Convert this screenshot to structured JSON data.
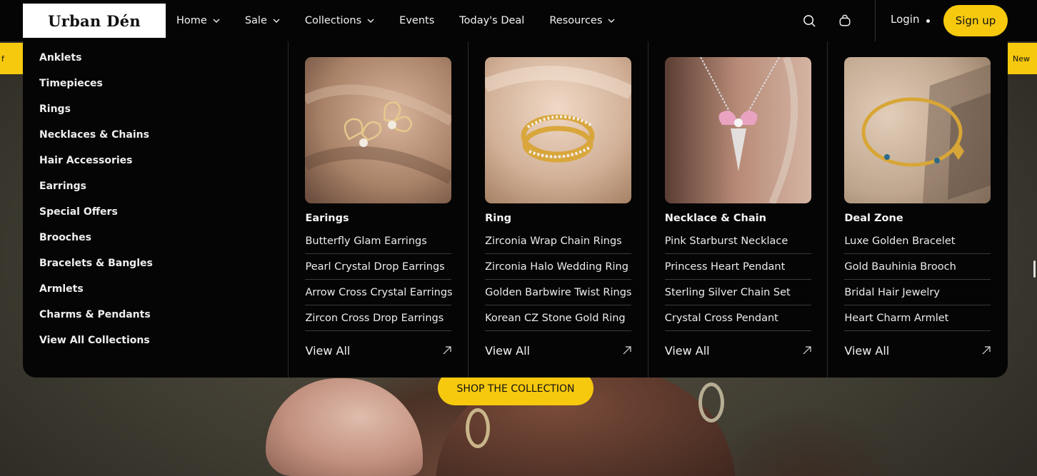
{
  "brand": {
    "logo_text": "Urban Dén"
  },
  "nav": {
    "items": [
      {
        "label": "Home",
        "dropdown": true
      },
      {
        "label": "Sale",
        "dropdown": true
      },
      {
        "label": "Collections",
        "dropdown": true
      },
      {
        "label": "Events",
        "dropdown": false
      },
      {
        "label": "Today's Deal",
        "dropdown": false
      },
      {
        "label": "Resources",
        "dropdown": true
      }
    ],
    "search_icon": "search-icon",
    "cart_icon": "cart-icon",
    "login_label": "Login",
    "signup_label": "Sign up"
  },
  "promo": {
    "left_text": "f",
    "right_text": "New"
  },
  "mega_menu": {
    "categories": [
      "Anklets",
      "Timepieces",
      "Rings",
      "Necklaces & Chains",
      "Hair Accessories",
      "Earrings",
      "Special Offers",
      "Brooches",
      "Bracelets & Bangles",
      "Armlets",
      "Charms & Pendants",
      "View All Collections"
    ],
    "columns": [
      {
        "title": "Earings",
        "links": [
          "Butterfly Glam Earrings",
          "Pearl Crystal Drop Earrings",
          "Arrow Cross Crystal Earrings",
          "Zircon Cross Drop Earrings"
        ],
        "view_all": "View All"
      },
      {
        "title": "Ring",
        "links": [
          "Zirconia Wrap Chain Rings",
          "Zirconia Halo Wedding Ring",
          "Golden Barbwire Twist Rings",
          "Korean CZ Stone Gold Ring"
        ],
        "view_all": "View All"
      },
      {
        "title": "Necklace & Chain",
        "links": [
          "Pink Starburst Necklace",
          "Princess Heart Pendant",
          "Sterling Silver Chain Set",
          "Crystal Cross Pendant"
        ],
        "view_all": "View All"
      },
      {
        "title": "Deal Zone",
        "links": [
          "Luxe Golden Bracelet",
          "Gold Bauhinia Brooch",
          "Bridal Hair Jewelry",
          "Heart Charm Armlet"
        ],
        "view_all": "View All"
      }
    ]
  },
  "hero": {
    "cta_label": "SHOP THE COLLECTION"
  },
  "colors": {
    "accent": "#f6c90e",
    "header_bg": "#050505"
  }
}
